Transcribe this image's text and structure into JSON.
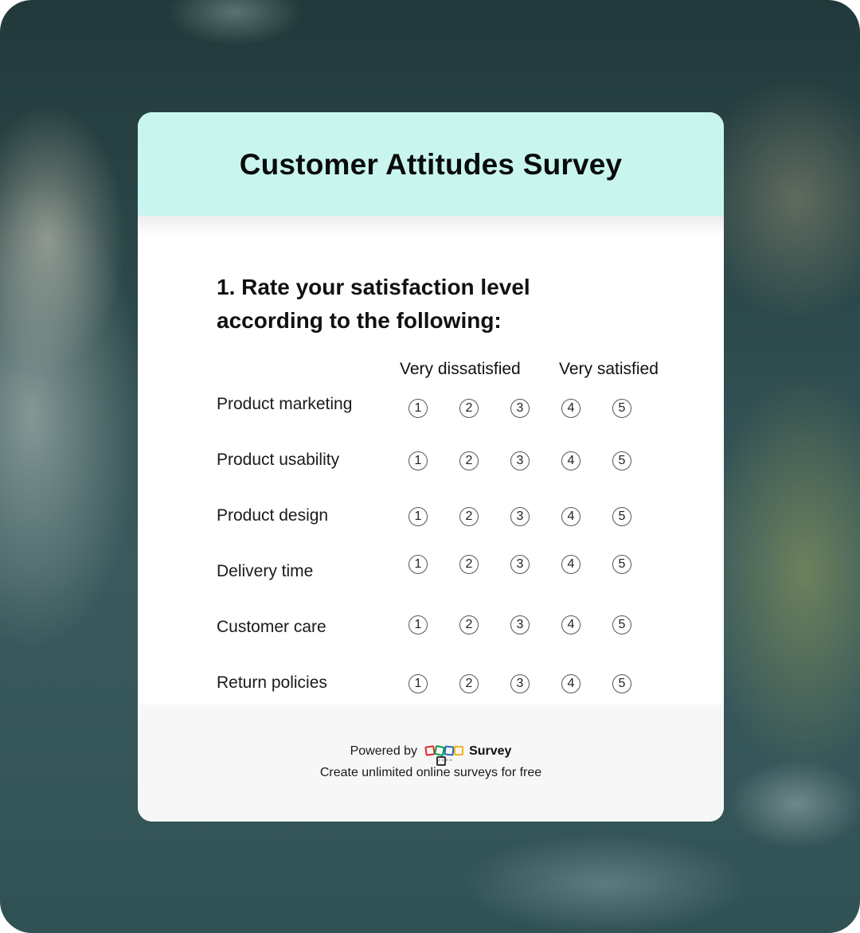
{
  "survey": {
    "title": "Customer Attitudes Survey",
    "question": "1. Rate your satisfaction level according to the following:",
    "scale": {
      "low_label": "Very dissatisfied",
      "high_label": "Very satisfied",
      "options": [
        "1",
        "2",
        "3",
        "4",
        "5"
      ]
    },
    "rows": [
      {
        "label": "Product marketing"
      },
      {
        "label": "Product usability"
      },
      {
        "label": "Product design"
      },
      {
        "label": "Delivery time"
      },
      {
        "label": "Customer care"
      },
      {
        "label": "Return policies"
      }
    ]
  },
  "footer": {
    "powered_by": "Powered by",
    "logo_icon": "zoho-logo-icon",
    "logo_small_text": "ZOHO",
    "brand": "Survey",
    "tagline": "Create unlimited online surveys for free"
  },
  "colors": {
    "header_bg": "#c8f6ef",
    "footer_bg": "#f7f7f7",
    "zoho_red": "#e42527",
    "zoho_green": "#089949",
    "zoho_blue": "#226db4",
    "zoho_yellow": "#f9b21d"
  }
}
